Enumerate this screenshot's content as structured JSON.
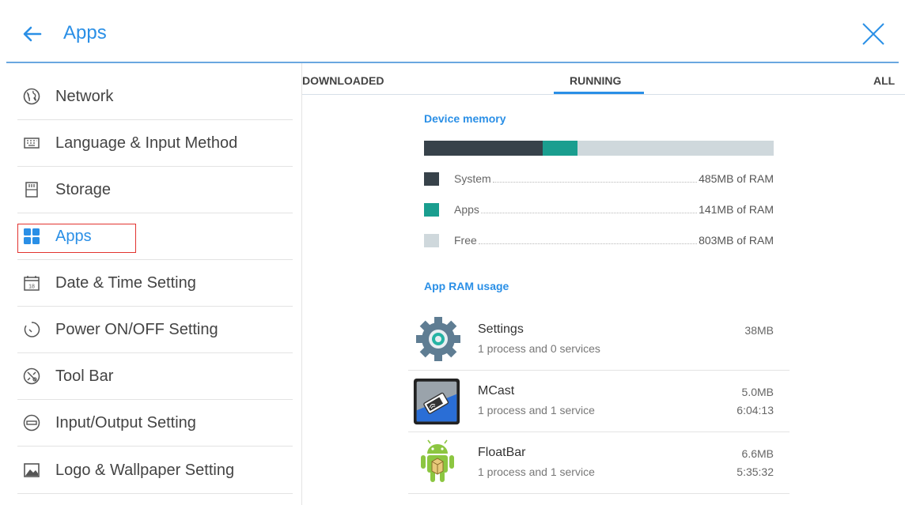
{
  "header": {
    "title": "Apps",
    "back_icon": "arrow-left-icon",
    "close_icon": "close-icon",
    "accent": "#2a8fe6"
  },
  "sidebar": {
    "items": [
      {
        "label": "Network",
        "icon": "globe-icon"
      },
      {
        "label": "Language & Input Method",
        "icon": "keyboard-icon"
      },
      {
        "label": "Storage",
        "icon": "sd-card-icon"
      },
      {
        "label": "Apps",
        "icon": "apps-grid-icon",
        "active": true
      },
      {
        "label": "Date & Time Setting",
        "icon": "calendar-icon",
        "calendar_day": "18"
      },
      {
        "label": "Power ON/OFF Setting",
        "icon": "power-timer-icon"
      },
      {
        "label": "Tool Bar",
        "icon": "toolbar-icon"
      },
      {
        "label": "Input/Output Setting",
        "icon": "input-output-icon"
      },
      {
        "label": "Logo & Wallpaper Setting",
        "icon": "image-icon"
      }
    ]
  },
  "tabs": [
    {
      "label": "DOWNLOADED"
    },
    {
      "label": "RUNNING",
      "active": true
    },
    {
      "label": "ALL"
    }
  ],
  "memory": {
    "title": "Device memory",
    "legend": [
      {
        "name": "System",
        "value": "485MB of RAM",
        "color": "#37424a",
        "mb": 485
      },
      {
        "name": "Apps",
        "value": "141MB of RAM",
        "color": "#1a9e8f",
        "mb": 141
      },
      {
        "name": "Free",
        "value": "803MB of RAM",
        "color": "#cfd8dc",
        "mb": 803
      }
    ]
  },
  "app_usage": {
    "title": "App RAM usage",
    "apps": [
      {
        "name": "Settings",
        "desc": "1 process and 0 services",
        "size": "38MB",
        "time": "",
        "icon": "settings-gear-icon"
      },
      {
        "name": "MCast",
        "desc": "1 process and 1 service",
        "size": "5.0MB",
        "time": "6:04:13",
        "icon": "mcast-icon"
      },
      {
        "name": "FloatBar",
        "desc": "1 process and 1 service",
        "size": "6.6MB",
        "time": "5:35:32",
        "icon": "android-icon"
      }
    ]
  }
}
